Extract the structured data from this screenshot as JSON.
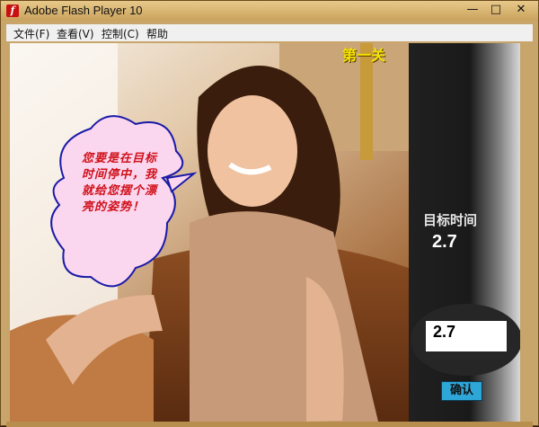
{
  "window": {
    "title": "Adobe Flash Player 10",
    "controls": [
      "—",
      "□",
      "✕"
    ]
  },
  "menu": [
    "文件(F)",
    "查看(V)",
    "控制(C)",
    "帮助"
  ],
  "game": {
    "level": "第一关",
    "speech_bubble": "您要是在目标时间停中，我就给您摆个漂亮的姿势！",
    "target_label": "目标时间",
    "target_value": "2.7",
    "timer_value": "2.7",
    "confirm_label": "确认"
  }
}
